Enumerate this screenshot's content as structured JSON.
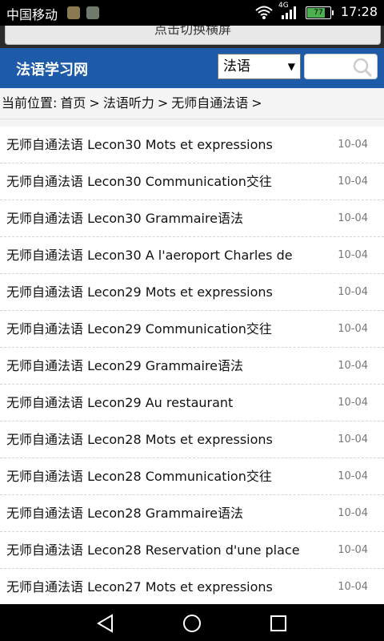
{
  "status_bar": {
    "carrier": "中国移动",
    "network": "4G",
    "battery": 77,
    "battery_label": "77",
    "time": "17:28"
  },
  "orientation_button": "点击切换横屏",
  "header": {
    "logo": "法语学习网",
    "language": "法语",
    "search_placeholder": ""
  },
  "breadcrumb": [
    "当前位置:",
    "首页",
    ">",
    "法语听力",
    ">",
    "无师自通法语",
    ">"
  ],
  "articles": [
    {
      "title": "无师自通法语 Lecon30 Mots et expressions",
      "date": "10-04"
    },
    {
      "title": "无师自通法语 Lecon30 Communication交往",
      "date": "10-04"
    },
    {
      "title": "无师自通法语 Lecon30 Grammaire语法",
      "date": "10-04"
    },
    {
      "title": "无师自通法语 Lecon30 A l'aeroport Charles de",
      "date": "10-04"
    },
    {
      "title": "无师自通法语 Lecon29 Mots et expressions",
      "date": "10-04"
    },
    {
      "title": "无师自通法语 Lecon29 Communication交往",
      "date": "10-04"
    },
    {
      "title": "无师自通法语 Lecon29 Grammaire语法",
      "date": "10-04"
    },
    {
      "title": "无师自通法语 Lecon29 Au restaurant",
      "date": "10-04"
    },
    {
      "title": "无师自通法语 Lecon28 Mots et expressions",
      "date": "10-04"
    },
    {
      "title": "无师自通法语 Lecon28 Communication交往",
      "date": "10-04"
    },
    {
      "title": "无师自通法语 Lecon28 Grammaire语法",
      "date": "10-04"
    },
    {
      "title": "无师自通法语 Lecon28 Reservation d'une place",
      "date": "10-04"
    },
    {
      "title": "无师自通法语 Lecon27 Mots et expressions",
      "date": "10-04"
    }
  ],
  "colors": {
    "header_bg": "#1d5ba8",
    "battery": "#4caf50"
  },
  "nav_icons": [
    "back-icon",
    "home-icon",
    "recents-icon"
  ]
}
